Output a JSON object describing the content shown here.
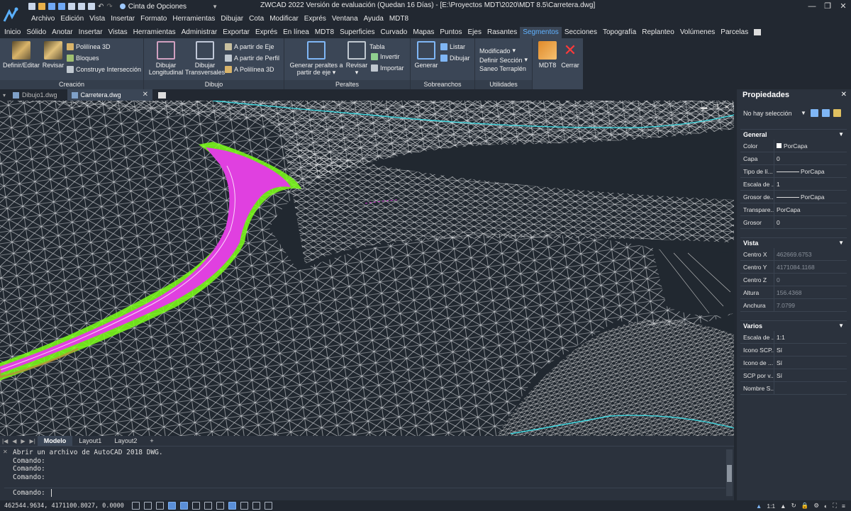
{
  "title": "ZWCAD 2022 Versión de evaluación (Quedan 16 Días) - [E:\\Proyectos MDT\\2020\\MDT 8.5\\Carretera.dwg]",
  "workspace": "Cinta de Opciones",
  "menu": [
    "Archivo",
    "Edición",
    "Vista",
    "Insertar",
    "Formato",
    "Herramientas",
    "Dibujar",
    "Cota",
    "Modificar",
    "Exprés",
    "Ventana",
    "Ayuda",
    "MDT8"
  ],
  "ribbon_tabs": [
    "Inicio",
    "Sólido",
    "Anotar",
    "Insertar",
    "Vistas",
    "Herramientas",
    "Administrar",
    "Exportar",
    "Exprés",
    "En línea",
    "MDT8",
    "Superficies",
    "Curvado",
    "Mapas",
    "Puntos",
    "Ejes",
    "Rasantes",
    "Segmentos",
    "Secciones",
    "Topografía",
    "Replanteo",
    "Volúmenes",
    "Parcelas"
  ],
  "active_tab": "Segmentos",
  "ribbon": {
    "creacion": {
      "title": "Creación",
      "definir": "Definir/Editar",
      "revisar": "Revisar",
      "polilinea3d": "Polilínea 3D",
      "bloques": "Bloques",
      "construye": "Construye Intersección"
    },
    "dibujo": {
      "title": "Dibujo",
      "long1": "Dibujar",
      "long2": "Longitudinal",
      "trans1": "Dibujar",
      "trans2": "Transversales",
      "eje": "A partir de Eje",
      "perfil": "A partir de Perfil",
      "poli": "A Polilínea 3D"
    },
    "peraltes": {
      "title": "Peraltes",
      "gen1": "Generar peraltes a",
      "gen2": "partir de eje",
      "revisar": "Revisar",
      "tabla": "Tabla",
      "invertir": "Invertir",
      "importar": "Importar"
    },
    "sobreanchos": {
      "title": "Sobreanchos",
      "generar": "Generar",
      "listar": "Listar",
      "dibujar": "Dibujar"
    },
    "utilidades": {
      "title": "Utilidades",
      "modificado": "Modificado",
      "definir": "Definir Sección",
      "saneo": "Saneo Terraplén"
    },
    "mdt8": {
      "label": "MDT8",
      "cerrar": "Cerrar"
    }
  },
  "doc_tabs": [
    "Dibujo1.dwg",
    "Carretera.dwg"
  ],
  "layout_tabs": [
    "Modelo",
    "Layout1",
    "Layout2",
    "+"
  ],
  "command": {
    "history": [
      "Abrir un archivo de AutoCAD 2018 DWG.",
      "Comando:",
      "Comando:",
      "Comando:"
    ],
    "prompt": "Comando:"
  },
  "status": {
    "coords": "462544.9634, 4171100.8027, 0.0000",
    "scale": "1:1"
  },
  "properties": {
    "title": "Propiedades",
    "selection": "No hay selección",
    "general": {
      "title": "General",
      "rows": [
        {
          "k": "Color",
          "v": "PorCapa"
        },
        {
          "k": "Capa",
          "v": "0"
        },
        {
          "k": "Tipo de lí...",
          "v": "PorCapa"
        },
        {
          "k": "Escala de ...",
          "v": "1"
        },
        {
          "k": "Grosor de...",
          "v": "PorCapa"
        },
        {
          "k": "Transpare...",
          "v": "PorCapa"
        },
        {
          "k": "Grosor",
          "v": "0"
        }
      ]
    },
    "vista": {
      "title": "Vista",
      "rows": [
        {
          "k": "Centro X",
          "v": "462669.6753"
        },
        {
          "k": "Centro Y",
          "v": "4171084.1168"
        },
        {
          "k": "Centro Z",
          "v": "0"
        },
        {
          "k": "Altura",
          "v": "156.4368"
        },
        {
          "k": "Anchura",
          "v": "7.0799"
        }
      ]
    },
    "varios": {
      "title": "Varios",
      "rows": [
        {
          "k": "Escala de ...",
          "v": "1:1"
        },
        {
          "k": "Icono SCP...",
          "v": "Sí"
        },
        {
          "k": "Icono de ...",
          "v": "Sí"
        },
        {
          "k": "SCP por v...",
          "v": "Sí"
        },
        {
          "k": "Nombre S...",
          "v": ""
        }
      ]
    }
  },
  "colors": {
    "accent": "#60b2ff",
    "road": "#e040e0",
    "embankment": "#7cff1a",
    "mesh": "#d8d8d8",
    "border_line": "#40d8e0"
  }
}
